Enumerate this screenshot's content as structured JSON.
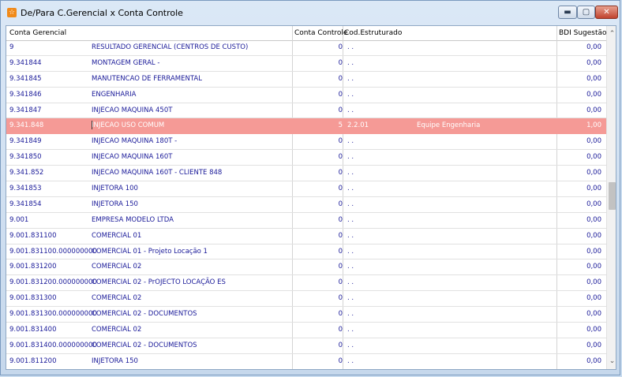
{
  "window": {
    "title": "De/Para C.Gerencial x Conta Controle",
    "icon": "app-icon",
    "controls": {
      "minimize": "minimize-icon",
      "maximize": "maximize-icon",
      "close": "close-icon"
    }
  },
  "colors": {
    "selected_row": "#f59a96",
    "text": "#1a1a99",
    "title_close": "#c0432e"
  },
  "grid": {
    "columns": [
      "Conta Gerencial",
      "",
      "Conta Controle",
      "Cod.Estruturado",
      "BDI Sugestão"
    ],
    "selected_index": 5,
    "rows": [
      {
        "conta": "9",
        "desc": "RESULTADO GERENCIAL (CENTROS DE CUSTO)",
        "ctrl": "0",
        "cod": ". .",
        "comp": "",
        "bdi": "0,00"
      },
      {
        "conta": "9.341844",
        "desc": "MONTAGEM GERAL -",
        "ctrl": "0",
        "cod": ". .",
        "comp": "",
        "bdi": "0,00"
      },
      {
        "conta": "9.341845",
        "desc": "MANUTENCAO DE FERRAMENTAL",
        "ctrl": "0",
        "cod": ". .",
        "comp": "",
        "bdi": "0,00"
      },
      {
        "conta": "9.341846",
        "desc": "ENGENHARIA",
        "ctrl": "0",
        "cod": ". .",
        "comp": "",
        "bdi": "0,00"
      },
      {
        "conta": "9.341847",
        "desc": "INJECAO MAQUINA 450T",
        "ctrl": "0",
        "cod": ". .",
        "comp": "",
        "bdi": "0,00"
      },
      {
        "conta": "9.341.848",
        "desc": "INJECAO USO COMUM",
        "ctrl": "5",
        "cod": "2.2.01",
        "comp": "Equipe Engenharia",
        "bdi": "1,00"
      },
      {
        "conta": "9.341849",
        "desc": "INJECAO MAQUINA 180T -",
        "ctrl": "0",
        "cod": ". .",
        "comp": "",
        "bdi": "0,00"
      },
      {
        "conta": "9.341850",
        "desc": "INJECAO MAQUINA 160T",
        "ctrl": "0",
        "cod": ". .",
        "comp": "",
        "bdi": "0,00"
      },
      {
        "conta": "9.341.852",
        "desc": "INJECAO MAQUINA 160T - CLIENTE   848",
        "ctrl": "0",
        "cod": ". .",
        "comp": "",
        "bdi": "0,00"
      },
      {
        "conta": "9.341853",
        "desc": "INJETORA 100",
        "ctrl": "0",
        "cod": ". .",
        "comp": "",
        "bdi": "0,00"
      },
      {
        "conta": "9.341854",
        "desc": "INJETORA 150",
        "ctrl": "0",
        "cod": ". .",
        "comp": "",
        "bdi": "0,00"
      },
      {
        "conta": "9.001",
        "desc": "EMPRESA MODELO LTDA",
        "ctrl": "0",
        "cod": ". .",
        "comp": "",
        "bdi": "0,00"
      },
      {
        "conta": "9.001.831100",
        "desc": "COMERCIAL 01",
        "ctrl": "0",
        "cod": ". .",
        "comp": "",
        "bdi": "0,00"
      },
      {
        "conta": "9.001.831100.000000000",
        "desc": "COMERCIAL 01 - Projeto Locação 1",
        "ctrl": "0",
        "cod": ". .",
        "comp": "",
        "bdi": "0,00"
      },
      {
        "conta": "9.001.831200",
        "desc": "COMERCIAL 02",
        "ctrl": "0",
        "cod": ". .",
        "comp": "",
        "bdi": "0,00"
      },
      {
        "conta": "9.001.831200.000000000",
        "desc": "COMERCIAL 02 - PrOJECTO LOCAÇÃO ES",
        "ctrl": "0",
        "cod": ". .",
        "comp": "",
        "bdi": "0,00"
      },
      {
        "conta": "9.001.831300",
        "desc": "COMERCIAL 02",
        "ctrl": "0",
        "cod": ". .",
        "comp": "",
        "bdi": "0,00"
      },
      {
        "conta": "9.001.831300.000000000",
        "desc": "COMERCIAL 02 - DOCUMENTOS",
        "ctrl": "0",
        "cod": ". .",
        "comp": "",
        "bdi": "0,00"
      },
      {
        "conta": "9.001.831400",
        "desc": "COMERCIAL 02",
        "ctrl": "0",
        "cod": ". .",
        "comp": "",
        "bdi": "0,00"
      },
      {
        "conta": "9.001.831400.000000000",
        "desc": "COMERCIAL 02 - DOCUMENTOS",
        "ctrl": "0",
        "cod": ". .",
        "comp": "",
        "bdi": "0,00"
      },
      {
        "conta": "9.001.811200",
        "desc": "INJETORA 150",
        "ctrl": "0",
        "cod": ". .",
        "comp": "",
        "bdi": "0,00"
      }
    ]
  },
  "scrollbar": {
    "up": "scroll-up-icon",
    "down": "scroll-down-icon"
  }
}
